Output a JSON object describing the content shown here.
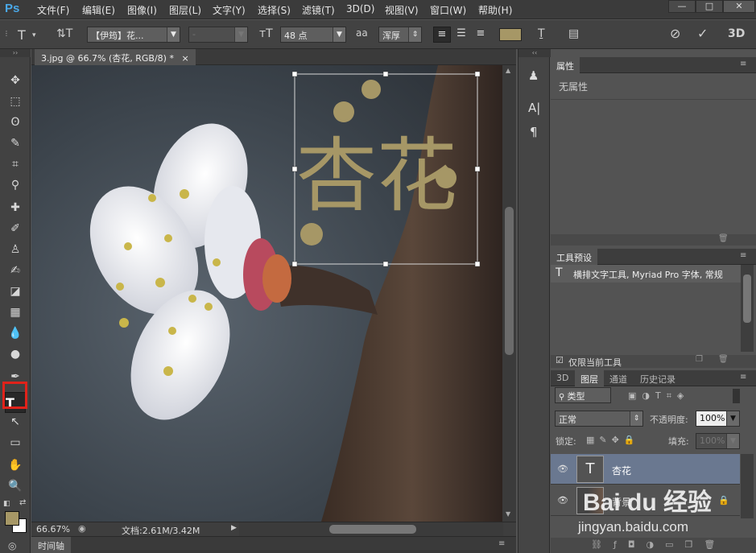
{
  "app": {
    "logo": "Ps"
  },
  "menu": [
    "文件(F)",
    "编辑(E)",
    "图像(I)",
    "图层(L)",
    "文字(Y)",
    "选择(S)",
    "滤镜(T)",
    "3D(D)",
    "视图(V)",
    "窗口(W)",
    "帮助(H)"
  ],
  "window_controls": {
    "minimize": "—",
    "maximize": "□",
    "close": "✕"
  },
  "options": {
    "font_family": "【伊筠】花...",
    "font_style": "-",
    "font_size": "48 点",
    "antialias_label": "aa",
    "antialias": "浑厚",
    "text_color": "#a69766"
  },
  "document": {
    "tab_title": "3.jpg @ 66.7% (杏花, RGB/8) *",
    "close_glyph": "×",
    "overlay_text": "杏花",
    "overlay_color": "#a69766",
    "zoom": "66.67%",
    "doc_size": "文档:2.61M/3.42M"
  },
  "timeline": {
    "label": "时间轴"
  },
  "properties": {
    "tab": "属性",
    "empty_text": "无属性"
  },
  "tool_presets": {
    "tab": "工具预设",
    "item": "横排文字工具, Myriad Pro 字体, 常规",
    "current_only": "仅限当前工具"
  },
  "layers_panel": {
    "tabs": [
      "3D",
      "图层",
      "通道",
      "历史记录"
    ],
    "filter_kind": "类型",
    "blend_mode": "正常",
    "opacity_label": "不透明度:",
    "opacity": "100%",
    "lock_label": "锁定:",
    "fill_label": "填充:",
    "fill": "100%",
    "layers": [
      {
        "name": "杏花",
        "kind": "text"
      },
      {
        "name": "背景",
        "kind": "image"
      }
    ]
  },
  "watermark": {
    "brand": "Bai du 经验",
    "url": "jingyan.baidu.com"
  }
}
